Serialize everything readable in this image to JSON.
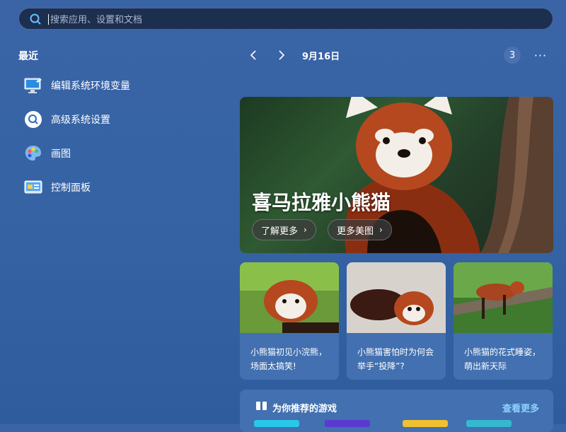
{
  "search": {
    "placeholder": "搜索应用、设置和文档"
  },
  "recent": {
    "title": "最近",
    "items": [
      {
        "label": "编辑系统环境变量",
        "icon": "monitor-settings-icon"
      },
      {
        "label": "高级系统设置",
        "icon": "magnifier-icon"
      },
      {
        "label": "画图",
        "icon": "paint-palette-icon"
      },
      {
        "label": "控制面板",
        "icon": "control-panel-icon"
      }
    ]
  },
  "header": {
    "date": "9月16日",
    "badge_count": "3",
    "more_glyph": "···"
  },
  "hero": {
    "title": "喜马拉雅小熊猫",
    "buttons": [
      "了解更多",
      "更多美图"
    ]
  },
  "cards": [
    {
      "text": "小熊猫初见小浣熊，场面太搞笑!"
    },
    {
      "text": "小熊猫害怕时为何会举手“投降”?"
    },
    {
      "text": "小熊猫的花式睡姿，萌出新天际"
    }
  ],
  "games": {
    "title": "为你推荐的游戏",
    "more": "查看更多"
  },
  "colors": {
    "accent_link": "#8fd0ff",
    "search_bg": "#1d2f4f"
  }
}
